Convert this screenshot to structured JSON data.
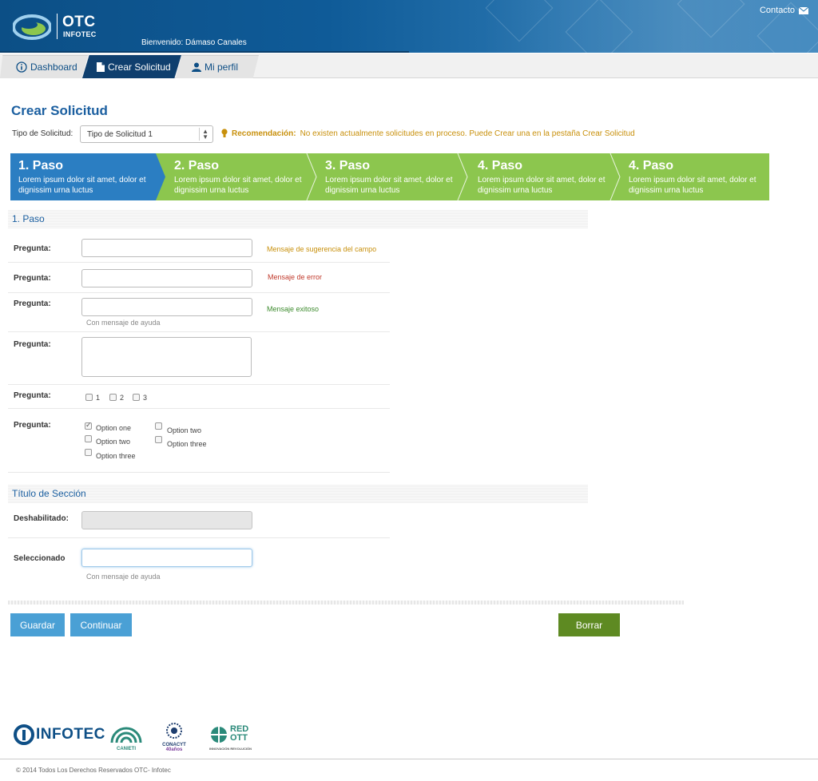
{
  "header": {
    "logo_title": "OTC",
    "logo_subtitle": "INFOTEC",
    "welcome": "Bienvenido: Dámaso Canales",
    "contact_label": "Contacto"
  },
  "nav": {
    "tabs": [
      {
        "label": "Dashboard"
      },
      {
        "label": "Crear Solicitud"
      },
      {
        "label": "Mi perfil"
      }
    ]
  },
  "page": {
    "title": "Crear Solicitud",
    "tipo_label": "Tipo de Solicitud:",
    "tipo_value": "Tipo de Solicitud 1",
    "recommendation_label": "Recomendación:",
    "recommendation_text": "No existen  actualmente solicitudes en proceso. Puede Crear una en la pestaña Crear Solicitud"
  },
  "steps": [
    {
      "title": "1. Paso",
      "desc": "Lorem ipsum dolor sit amet, dolor et dignissim urna luctus",
      "active": true
    },
    {
      "title": "2. Paso",
      "desc": "Lorem ipsum dolor sit amet, dolor et dignissim urna luctus",
      "active": false
    },
    {
      "title": "3. Paso",
      "desc": "Lorem ipsum dolor sit amet, dolor et dignissim urna luctus",
      "active": false
    },
    {
      "title": "4. Paso",
      "desc": "Lorem ipsum dolor sit amet, dolor et dignissim urna luctus",
      "active": false
    },
    {
      "title": "4. Paso",
      "desc": "Lorem ipsum dolor sit amet, dolor et dignissim urna luctus",
      "active": false
    }
  ],
  "section1": {
    "title": "1. Paso",
    "rows": [
      {
        "label": "Pregunta:",
        "message": "Mensaje de sugerencia del campo"
      },
      {
        "label": "Pregunta:",
        "message": "Mensaje de error"
      },
      {
        "label": "Pregunta:",
        "message": "Mensaje exitoso",
        "hint": "Con mensaje de ayuda"
      },
      {
        "label": "Pregunta:"
      },
      {
        "label": "Pregunta:",
        "checkboxes": [
          "1",
          "2",
          "3"
        ]
      },
      {
        "label": "Pregunta:"
      }
    ],
    "options_col1": [
      "Option one",
      "Option two",
      "Option three"
    ],
    "options_col2": [
      "Option two",
      "Option three"
    ]
  },
  "section2": {
    "title": "Título de Sección",
    "disabled_label": "Deshabilitado:",
    "selected_label": "Seleccionado",
    "selected_hint": "Con mensaje de ayuda"
  },
  "actions": {
    "save": "Guardar",
    "continue": "Continuar",
    "delete": "Borrar"
  },
  "footer": {
    "logos": [
      "INFOTEC",
      "CANIETI",
      "CONACYT",
      "RED OTT"
    ],
    "conacyt_years": "40",
    "conacyt_years_suffix": "años",
    "red_ott_tagline": "INNOVACIÓN REVOLUCIÓN",
    "copyright": "© 2014  Todos Los Derechos Reservados OTC- Infotec"
  },
  "colors": {
    "brand_blue": "#0f5b98",
    "active_step": "#2b7ec2",
    "inactive_step": "#8cc64e",
    "hint_orange": "#c8900c",
    "error_red": "#c0392b",
    "success_green": "#3d8b2e",
    "button_blue": "#4aa0d5",
    "button_green": "#5e8a22"
  }
}
